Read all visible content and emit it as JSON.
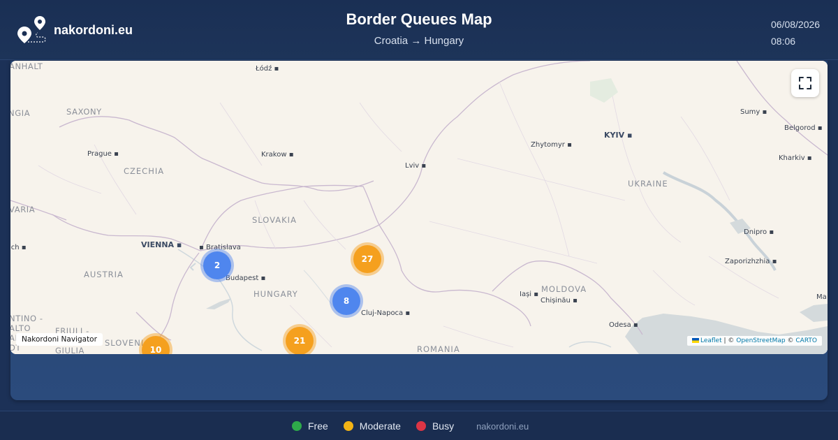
{
  "header": {
    "site_name": "nakordoni.eu",
    "title": "Border Queues Map",
    "route": "Croatia → Hungary",
    "date": "06/08/2026",
    "time": "08:06"
  },
  "map": {
    "country_labels": [
      "CZECHIA",
      "SLOVAKIA",
      "AUSTRIA",
      "HUNGARY",
      "UKRAINE",
      "MOLDOVA",
      "ROMANIA",
      "SLOVENIA"
    ],
    "region_labels": [
      "ANHALT",
      "SAXONY",
      "NGIA",
      "VARIA",
      "NTINO - ALTO ADIGE/ DT",
      "FRIULI - VENEZIA GIULIA"
    ],
    "city_labels": [
      "Łódź",
      "Prague",
      "Krakow",
      "Lviv",
      "Zhytomyr",
      "KYIV",
      "Sumy",
      "Belgorod",
      "Kharkiv",
      "VIENNA",
      "Bratislava",
      "Budapest",
      "Cluj-Napoca",
      "Iași",
      "Chișinău",
      "Dnipro",
      "Zaporizhzhia",
      "Odesa",
      "Ma",
      "ich"
    ],
    "clusters": [
      {
        "count": "2",
        "status": "free"
      },
      {
        "count": "27",
        "status": "moderate"
      },
      {
        "count": "8",
        "status": "free"
      },
      {
        "count": "21",
        "status": "moderate"
      },
      {
        "count": "10",
        "status": "moderate"
      }
    ],
    "navigator_badge": "Nakordoni Navigator",
    "attribution": {
      "leaflet": "Leaflet",
      "sep1": " | © ",
      "osm": "OpenStreetMap",
      "sep2": " © ",
      "carto": "CARTO"
    },
    "fullscreen_icon": "fullscreen-icon"
  },
  "legend": {
    "items": [
      {
        "label": "Free",
        "color": "#2eaa4a"
      },
      {
        "label": "Moderate",
        "color": "#f2b315"
      },
      {
        "label": "Busy",
        "color": "#dc3545"
      }
    ],
    "site": "nakordoni.eu"
  },
  "colors": {
    "header_bg": "#1a2f54",
    "map_land": "#f7f3ec",
    "map_water": "#d4dadc",
    "cluster_free": "#4f86ee",
    "cluster_moderate": "#f5a01e"
  }
}
